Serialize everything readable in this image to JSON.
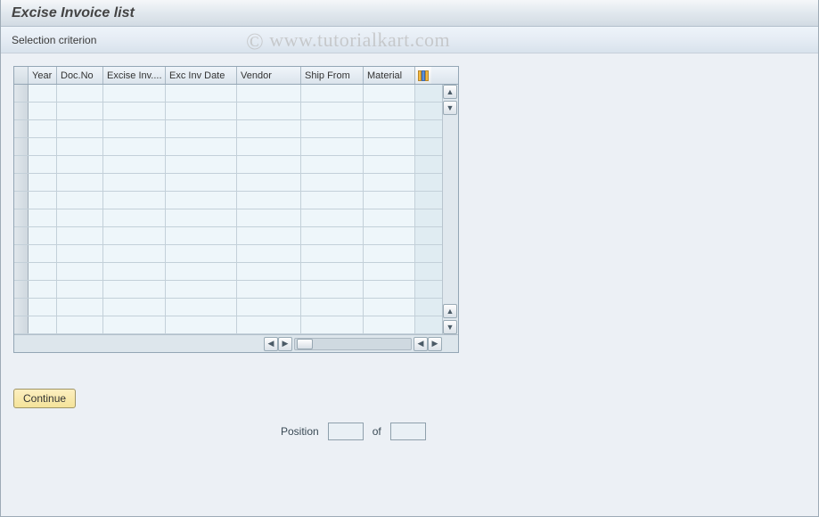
{
  "header": {
    "title": "Excise Invoice list"
  },
  "toolbar": {
    "selection_criterion": "Selection criterion"
  },
  "watermark": {
    "copy": "©",
    "text": "www.tutorialkart.com"
  },
  "grid": {
    "columns": {
      "year": "Year",
      "docno": "Doc.No",
      "excinv": "Excise Inv....",
      "excdt": "Exc Inv Date",
      "vendor": "Vendor",
      "shipf": "Ship From",
      "mat": "Material"
    },
    "rows": 14,
    "config_icon": "configure-columns-icon"
  },
  "actions": {
    "continue": "Continue"
  },
  "position": {
    "label": "Position",
    "of": "of",
    "current": "",
    "total": ""
  }
}
